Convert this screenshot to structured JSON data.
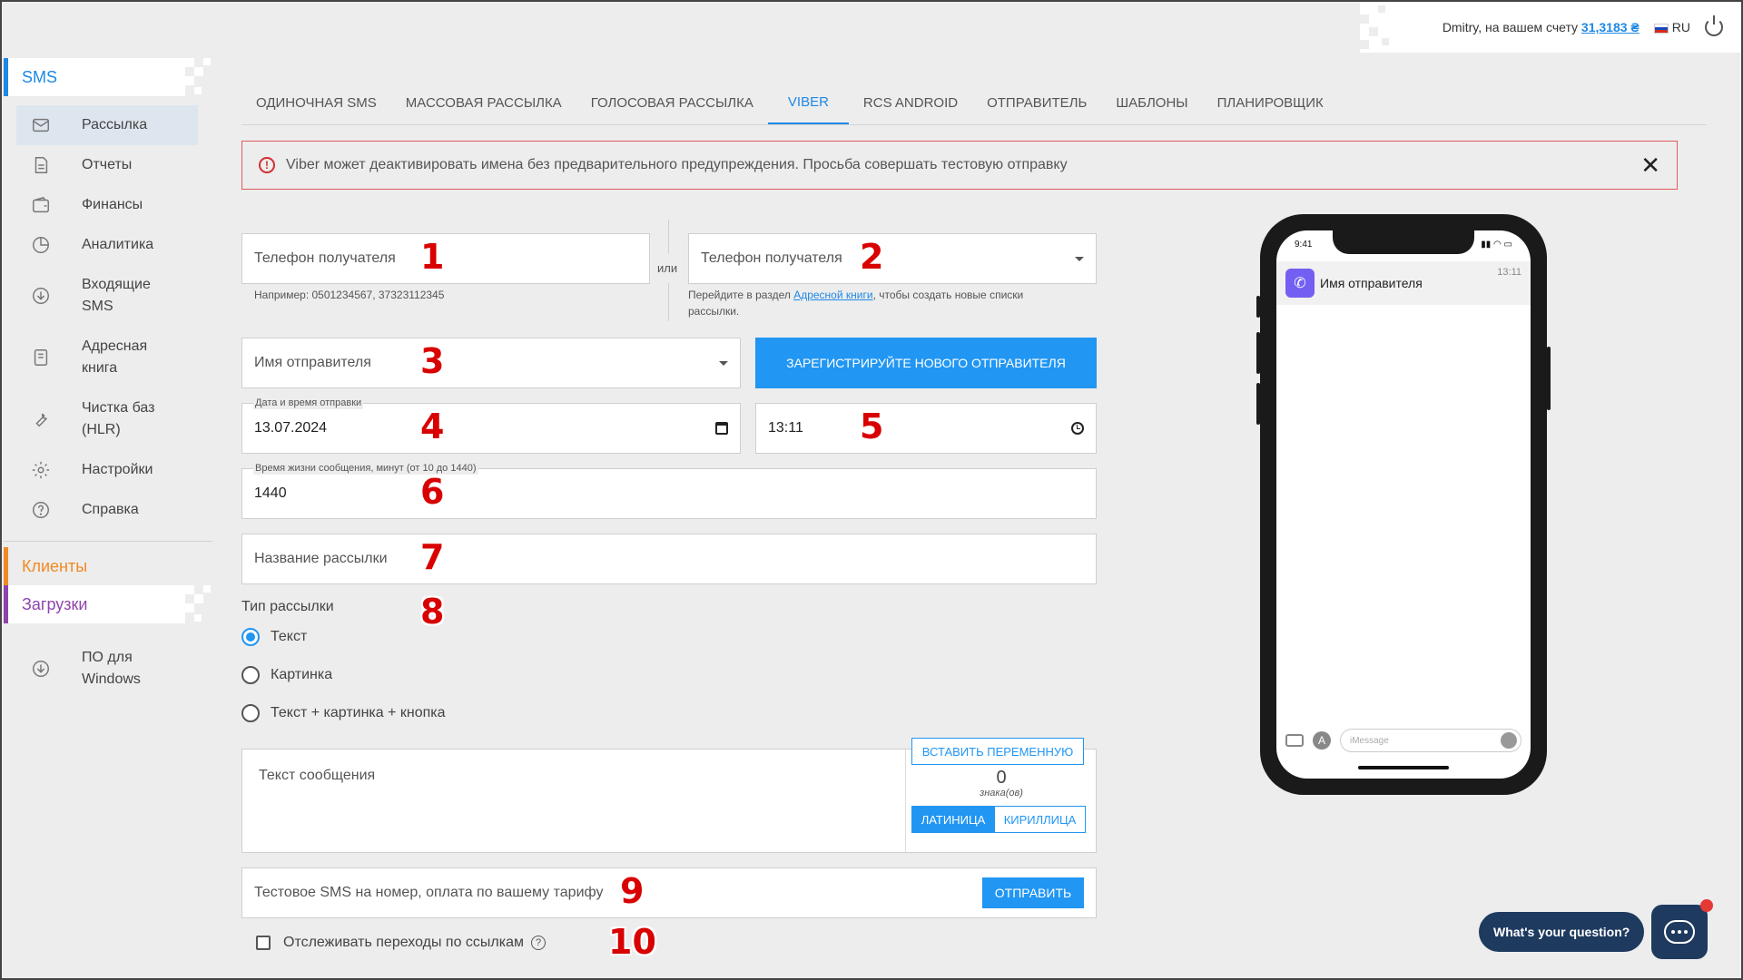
{
  "topbar": {
    "user_label": "Dmitry, на вашем счету",
    "balance": "31,3183 ₴",
    "language": "RU"
  },
  "sidebar": {
    "sms_section": "SMS",
    "items": [
      {
        "label": "Рассылка",
        "icon": "envelope-icon"
      },
      {
        "label": "Отчеты",
        "icon": "document-icon"
      },
      {
        "label": "Финансы",
        "icon": "wallet-icon"
      },
      {
        "label": "Аналитика",
        "icon": "pie-chart-icon"
      },
      {
        "label": "Входящие SMS",
        "icon": "inbox-download-icon"
      },
      {
        "label": "Адресная книга",
        "icon": "address-book-icon"
      },
      {
        "label": "Чистка баз (HLR)",
        "icon": "wrench-icon"
      },
      {
        "label": "Настройки",
        "icon": "gear-icon"
      },
      {
        "label": "Справка",
        "icon": "help-icon"
      }
    ],
    "clients_section": "Клиенты",
    "downloads_section": "Загрузки",
    "windows_item": "ПО для Windows"
  },
  "tabs": [
    "ОДИНОЧНАЯ SMS",
    "МАССОВАЯ РАССЫЛКА",
    "ГОЛОСОВАЯ РАССЫЛКА",
    "VIBER",
    "RCS ANDROID",
    "ОТПРАВИТЕЛЬ",
    "ШАБЛОНЫ",
    "ПЛАНИРОВЩИК"
  ],
  "active_tab": "VIBER",
  "alert": {
    "text": "Viber может деактивировать имена без предварительного предупреждения. Просьба совершать тестовую отправку",
    "close": "✕"
  },
  "form": {
    "phone_placeholder": "Телефон получателя",
    "phone_hint": "Например: 0501234567, 37323112345",
    "or_label": "или",
    "phone_list_placeholder": "Телефон получателя",
    "list_hint_before": "Перейдите в раздел ",
    "list_hint_link": "Адресной книги",
    "list_hint_after": ", чтобы создать новые списки рассылки.",
    "sender_placeholder": "Имя отправителя",
    "register_button": "ЗАРЕГИСТРИРУЙТЕ НОВОГО ОТПРАВИТЕЛЯ",
    "date_label": "Дата и время отправки",
    "date_value": "13.07.2024",
    "time_value": "13:11",
    "ttl_label": "Время жизни сообщения, минут (от 10 до 1440)",
    "ttl_value": "1440",
    "campaign_placeholder": "Название рассылки",
    "type_label": "Тип рассылки",
    "types": [
      "Текст",
      "Картинка",
      "Текст + картинка + кнопка"
    ],
    "message_placeholder": "Текст сообщения",
    "insert_variable": "ВСТАВИТЬ ПЕРЕМЕННУЮ",
    "char_count": "0",
    "char_unit": "знака(ов)",
    "latin": "ЛАТИНИЦА",
    "cyrillic": "КИРИЛЛИЦА",
    "test_placeholder": "Тестовое SMS на номер, оплата по вашему тарифу",
    "send_button": "ОТПРАВИТЬ",
    "track_links": "Отслеживать переходы по ссылкам"
  },
  "markers": [
    "1",
    "2",
    "3",
    "4",
    "5",
    "6",
    "7",
    "8",
    "9",
    "10"
  ],
  "phone_preview": {
    "status_time": "9:41",
    "sender": "Имя отправителя",
    "time": "13:11",
    "imessage_placeholder": "iMessage"
  },
  "chat_widget": {
    "label": "What's your question?"
  }
}
